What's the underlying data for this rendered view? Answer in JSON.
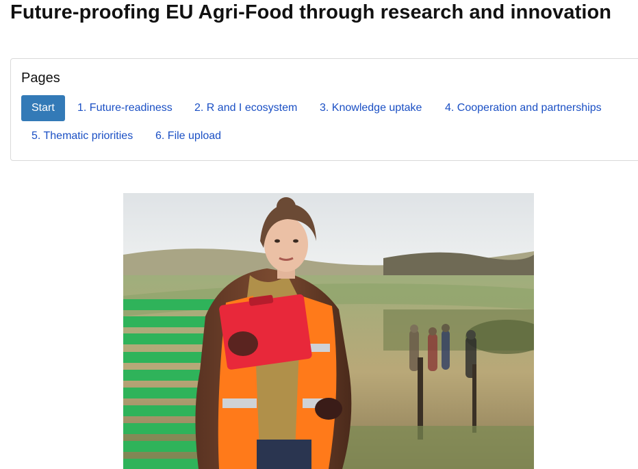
{
  "header": {
    "title": "Future-proofing EU Agri-Food through research and innovation"
  },
  "pages_panel": {
    "heading": "Pages",
    "items": [
      {
        "label": "Start",
        "active": true
      },
      {
        "label": "1. Future-readiness",
        "active": false
      },
      {
        "label": "2. R and I ecosystem",
        "active": false
      },
      {
        "label": "3. Knowledge uptake",
        "active": false
      },
      {
        "label": "4. Cooperation and partnerships",
        "active": false
      },
      {
        "label": "5. Thematic priorities",
        "active": false
      },
      {
        "label": "6. File upload",
        "active": false
      }
    ]
  },
  "hero_image": {
    "icon": "photo-farmer-with-clipboard"
  },
  "colors": {
    "active_button": "#337ab7",
    "link": "#1a4fc4",
    "stripe_green": "#2fb35a",
    "vest_orange": "#ff7a1a",
    "clipboard_red": "#e8283a"
  }
}
